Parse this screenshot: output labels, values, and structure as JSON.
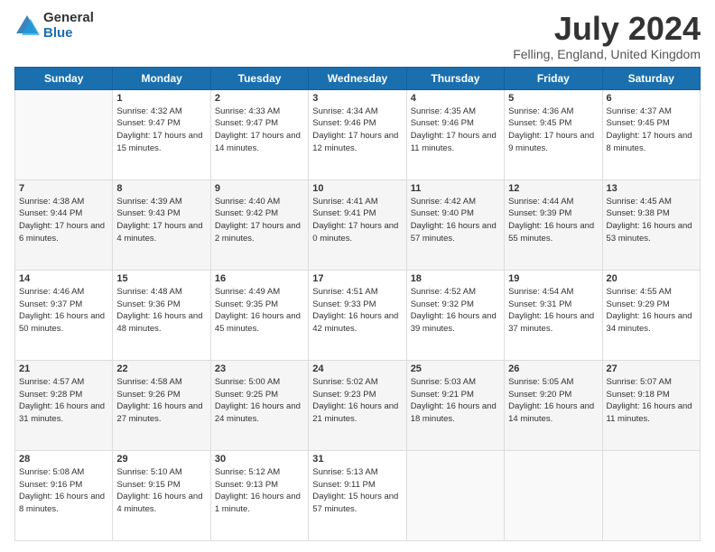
{
  "logo": {
    "general": "General",
    "blue": "Blue"
  },
  "header": {
    "month_year": "July 2024",
    "location": "Felling, England, United Kingdom"
  },
  "days_of_week": [
    "Sunday",
    "Monday",
    "Tuesday",
    "Wednesday",
    "Thursday",
    "Friday",
    "Saturday"
  ],
  "weeks": [
    [
      {
        "day": "",
        "sunrise": "",
        "sunset": "",
        "daylight": ""
      },
      {
        "day": "1",
        "sunrise": "Sunrise: 4:32 AM",
        "sunset": "Sunset: 9:47 PM",
        "daylight": "Daylight: 17 hours and 15 minutes."
      },
      {
        "day": "2",
        "sunrise": "Sunrise: 4:33 AM",
        "sunset": "Sunset: 9:47 PM",
        "daylight": "Daylight: 17 hours and 14 minutes."
      },
      {
        "day": "3",
        "sunrise": "Sunrise: 4:34 AM",
        "sunset": "Sunset: 9:46 PM",
        "daylight": "Daylight: 17 hours and 12 minutes."
      },
      {
        "day": "4",
        "sunrise": "Sunrise: 4:35 AM",
        "sunset": "Sunset: 9:46 PM",
        "daylight": "Daylight: 17 hours and 11 minutes."
      },
      {
        "day": "5",
        "sunrise": "Sunrise: 4:36 AM",
        "sunset": "Sunset: 9:45 PM",
        "daylight": "Daylight: 17 hours and 9 minutes."
      },
      {
        "day": "6",
        "sunrise": "Sunrise: 4:37 AM",
        "sunset": "Sunset: 9:45 PM",
        "daylight": "Daylight: 17 hours and 8 minutes."
      }
    ],
    [
      {
        "day": "7",
        "sunrise": "Sunrise: 4:38 AM",
        "sunset": "Sunset: 9:44 PM",
        "daylight": "Daylight: 17 hours and 6 minutes."
      },
      {
        "day": "8",
        "sunrise": "Sunrise: 4:39 AM",
        "sunset": "Sunset: 9:43 PM",
        "daylight": "Daylight: 17 hours and 4 minutes."
      },
      {
        "day": "9",
        "sunrise": "Sunrise: 4:40 AM",
        "sunset": "Sunset: 9:42 PM",
        "daylight": "Daylight: 17 hours and 2 minutes."
      },
      {
        "day": "10",
        "sunrise": "Sunrise: 4:41 AM",
        "sunset": "Sunset: 9:41 PM",
        "daylight": "Daylight: 17 hours and 0 minutes."
      },
      {
        "day": "11",
        "sunrise": "Sunrise: 4:42 AM",
        "sunset": "Sunset: 9:40 PM",
        "daylight": "Daylight: 16 hours and 57 minutes."
      },
      {
        "day": "12",
        "sunrise": "Sunrise: 4:44 AM",
        "sunset": "Sunset: 9:39 PM",
        "daylight": "Daylight: 16 hours and 55 minutes."
      },
      {
        "day": "13",
        "sunrise": "Sunrise: 4:45 AM",
        "sunset": "Sunset: 9:38 PM",
        "daylight": "Daylight: 16 hours and 53 minutes."
      }
    ],
    [
      {
        "day": "14",
        "sunrise": "Sunrise: 4:46 AM",
        "sunset": "Sunset: 9:37 PM",
        "daylight": "Daylight: 16 hours and 50 minutes."
      },
      {
        "day": "15",
        "sunrise": "Sunrise: 4:48 AM",
        "sunset": "Sunset: 9:36 PM",
        "daylight": "Daylight: 16 hours and 48 minutes."
      },
      {
        "day": "16",
        "sunrise": "Sunrise: 4:49 AM",
        "sunset": "Sunset: 9:35 PM",
        "daylight": "Daylight: 16 hours and 45 minutes."
      },
      {
        "day": "17",
        "sunrise": "Sunrise: 4:51 AM",
        "sunset": "Sunset: 9:33 PM",
        "daylight": "Daylight: 16 hours and 42 minutes."
      },
      {
        "day": "18",
        "sunrise": "Sunrise: 4:52 AM",
        "sunset": "Sunset: 9:32 PM",
        "daylight": "Daylight: 16 hours and 39 minutes."
      },
      {
        "day": "19",
        "sunrise": "Sunrise: 4:54 AM",
        "sunset": "Sunset: 9:31 PM",
        "daylight": "Daylight: 16 hours and 37 minutes."
      },
      {
        "day": "20",
        "sunrise": "Sunrise: 4:55 AM",
        "sunset": "Sunset: 9:29 PM",
        "daylight": "Daylight: 16 hours and 34 minutes."
      }
    ],
    [
      {
        "day": "21",
        "sunrise": "Sunrise: 4:57 AM",
        "sunset": "Sunset: 9:28 PM",
        "daylight": "Daylight: 16 hours and 31 minutes."
      },
      {
        "day": "22",
        "sunrise": "Sunrise: 4:58 AM",
        "sunset": "Sunset: 9:26 PM",
        "daylight": "Daylight: 16 hours and 27 minutes."
      },
      {
        "day": "23",
        "sunrise": "Sunrise: 5:00 AM",
        "sunset": "Sunset: 9:25 PM",
        "daylight": "Daylight: 16 hours and 24 minutes."
      },
      {
        "day": "24",
        "sunrise": "Sunrise: 5:02 AM",
        "sunset": "Sunset: 9:23 PM",
        "daylight": "Daylight: 16 hours and 21 minutes."
      },
      {
        "day": "25",
        "sunrise": "Sunrise: 5:03 AM",
        "sunset": "Sunset: 9:21 PM",
        "daylight": "Daylight: 16 hours and 18 minutes."
      },
      {
        "day": "26",
        "sunrise": "Sunrise: 5:05 AM",
        "sunset": "Sunset: 9:20 PM",
        "daylight": "Daylight: 16 hours and 14 minutes."
      },
      {
        "day": "27",
        "sunrise": "Sunrise: 5:07 AM",
        "sunset": "Sunset: 9:18 PM",
        "daylight": "Daylight: 16 hours and 11 minutes."
      }
    ],
    [
      {
        "day": "28",
        "sunrise": "Sunrise: 5:08 AM",
        "sunset": "Sunset: 9:16 PM",
        "daylight": "Daylight: 16 hours and 8 minutes."
      },
      {
        "day": "29",
        "sunrise": "Sunrise: 5:10 AM",
        "sunset": "Sunset: 9:15 PM",
        "daylight": "Daylight: 16 hours and 4 minutes."
      },
      {
        "day": "30",
        "sunrise": "Sunrise: 5:12 AM",
        "sunset": "Sunset: 9:13 PM",
        "daylight": "Daylight: 16 hours and 1 minute."
      },
      {
        "day": "31",
        "sunrise": "Sunrise: 5:13 AM",
        "sunset": "Sunset: 9:11 PM",
        "daylight": "Daylight: 15 hours and 57 minutes."
      },
      {
        "day": "",
        "sunrise": "",
        "sunset": "",
        "daylight": ""
      },
      {
        "day": "",
        "sunrise": "",
        "sunset": "",
        "daylight": ""
      },
      {
        "day": "",
        "sunrise": "",
        "sunset": "",
        "daylight": ""
      }
    ]
  ]
}
